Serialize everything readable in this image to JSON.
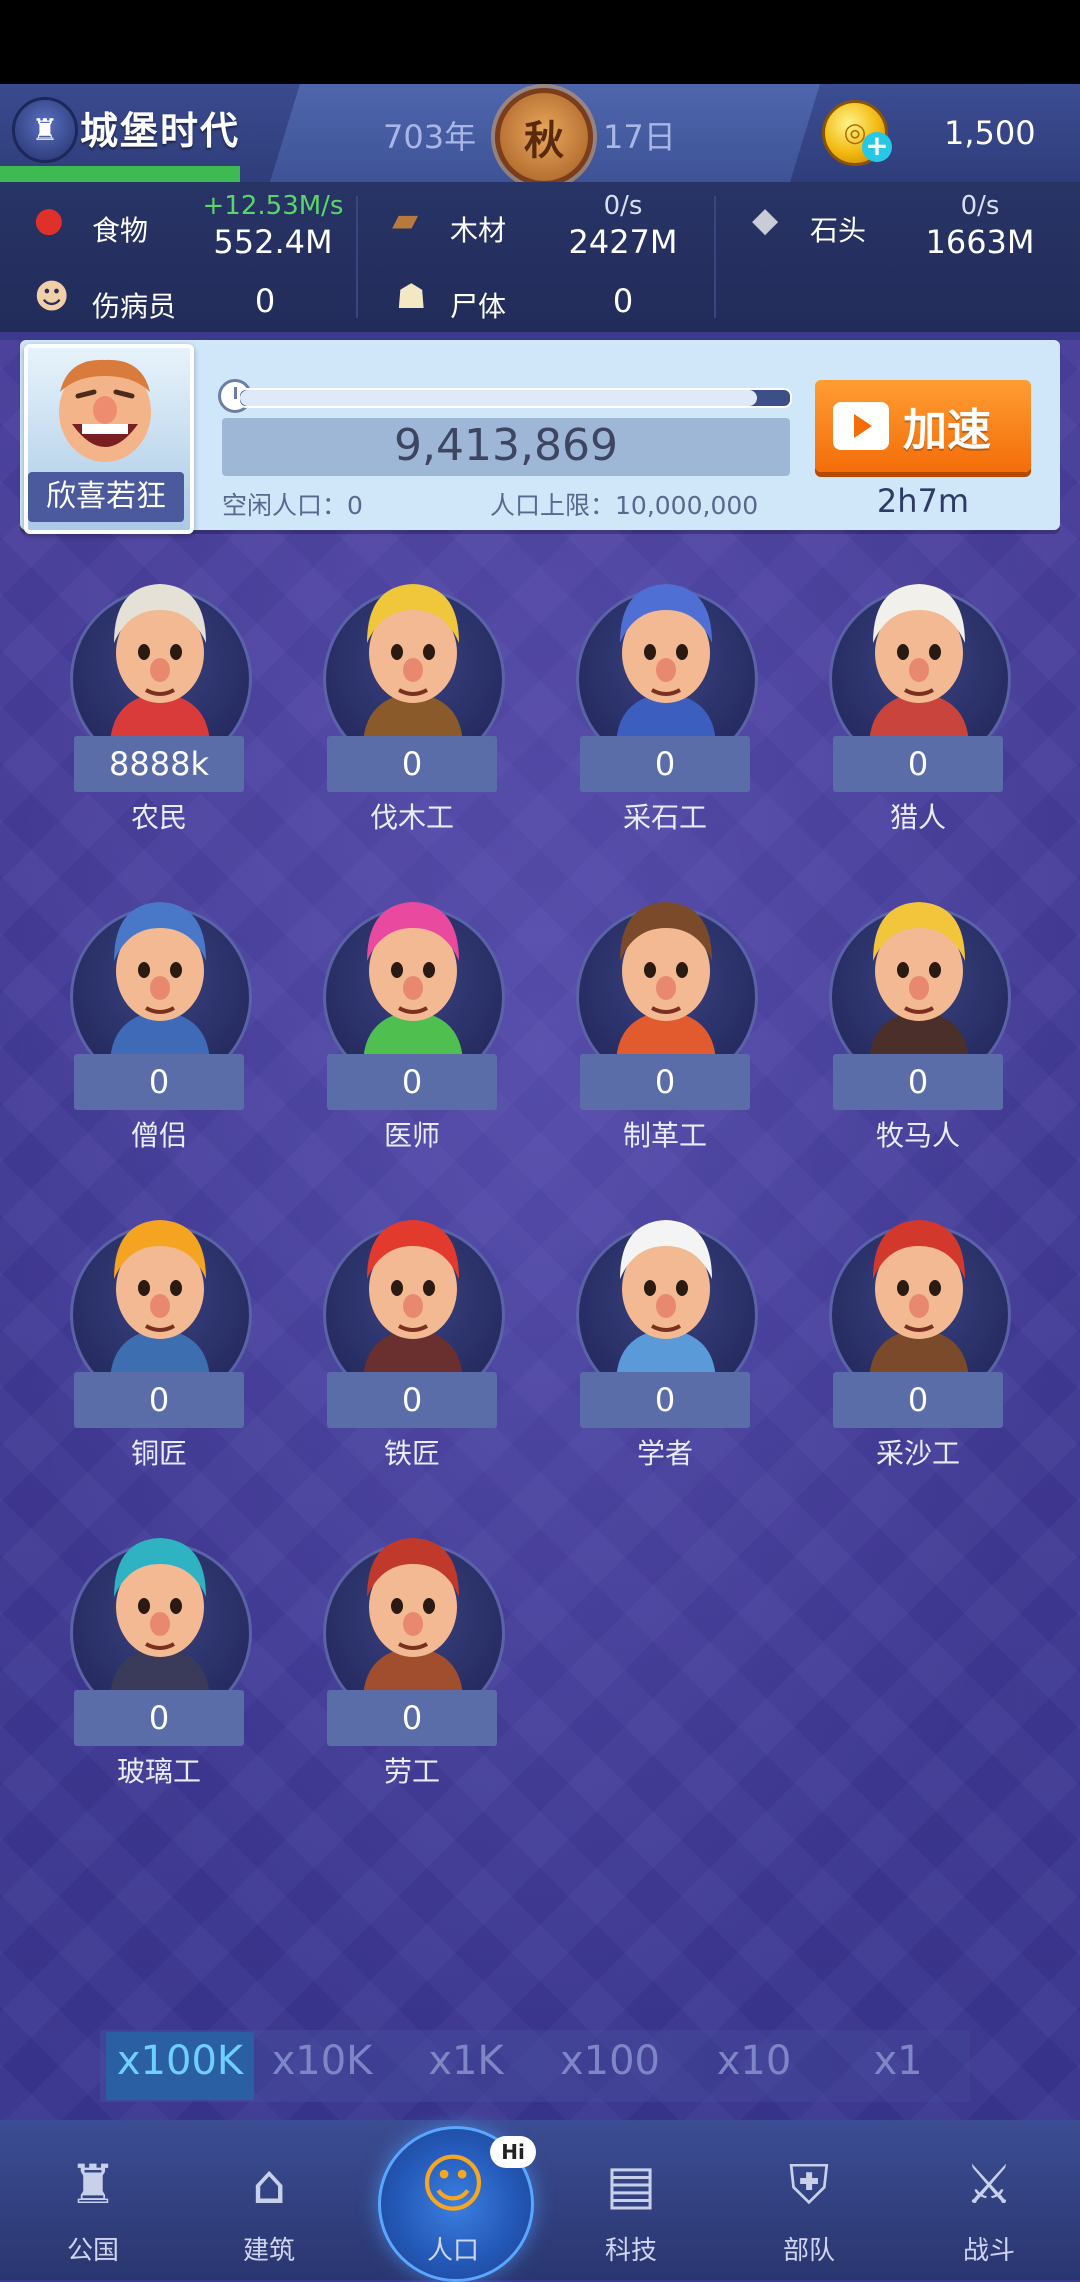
{
  "header": {
    "title": "城堡时代",
    "year": "703年",
    "season": "秋",
    "day": "17日",
    "coins": "1,500"
  },
  "resources": {
    "food": {
      "label": "食物",
      "rate": "+12.53M/s",
      "value": "552.4M",
      "icon": "apple-icon"
    },
    "wood": {
      "label": "木材",
      "rate": "0/s",
      "value": "2427M",
      "icon": "wood-icon"
    },
    "stone": {
      "label": "石头",
      "rate": "0/s",
      "value": "1663M",
      "icon": "stone-icon"
    },
    "wounded": {
      "label": "伤病员",
      "value": "0",
      "icon": "wounded-icon"
    },
    "corpse": {
      "label": "尸体",
      "value": "0",
      "icon": "corpse-icon"
    }
  },
  "population": {
    "mood": "欣喜若狂",
    "count": "9,413,869",
    "idle_label": "空闲人口：",
    "idle_value": "0",
    "limit_label": "人口上限：",
    "limit_value": "10,000,000",
    "progress": 0.94,
    "speed_label": "加速",
    "speed_time": "2h7m"
  },
  "workers": [
    {
      "name": "农民",
      "count": "8888k",
      "hair": "#e6e1d6",
      "shirt": "#d93a3a"
    },
    {
      "name": "伐木工",
      "count": "0",
      "hair": "#f0c63a",
      "shirt": "#8a5a2b"
    },
    {
      "name": "采石工",
      "count": "0",
      "hair": "#4f6fd4",
      "shirt": "#3c5fbf"
    },
    {
      "name": "猎人",
      "count": "0",
      "hair": "#f2f0ea",
      "shirt": "#c9443c"
    },
    {
      "name": "僧侣",
      "count": "0",
      "hair": "#4a78c8",
      "shirt": "#3e6ab8"
    },
    {
      "name": "医师",
      "count": "0",
      "hair": "#e94aa0",
      "shirt": "#4fbf4f"
    },
    {
      "name": "制革工",
      "count": "0",
      "hair": "#7a4a2a",
      "shirt": "#e25b2e"
    },
    {
      "name": "牧马人",
      "count": "0",
      "hair": "#f2c53a",
      "shirt": "#4a2f2a"
    },
    {
      "name": "铜匠",
      "count": "0",
      "hair": "#f4a421",
      "shirt": "#3d6fb0"
    },
    {
      "name": "铁匠",
      "count": "0",
      "hair": "#e23b2e",
      "shirt": "#6a3030"
    },
    {
      "name": "学者",
      "count": "0",
      "hair": "#f4f4f4",
      "shirt": "#5b9ad8"
    },
    {
      "name": "采沙工",
      "count": "0",
      "hair": "#d2392c",
      "shirt": "#7a4a2a"
    },
    {
      "name": "玻璃工",
      "count": "0",
      "hair": "#2fb2c2",
      "shirt": "#3a3a5a"
    },
    {
      "name": "劳工",
      "count": "0",
      "hair": "#c0392b",
      "shirt": "#a04e2e"
    }
  ],
  "multipliers": [
    "x100K",
    "x10K",
    "x1K",
    "x100",
    "x10",
    "x1"
  ],
  "multiplier_active": "x100K",
  "nav": [
    {
      "label": "公国",
      "icon": "castle-icon"
    },
    {
      "label": "建筑",
      "icon": "house-icon"
    },
    {
      "label": "人口",
      "icon": "person-icon",
      "badge": "Hi"
    },
    {
      "label": "科技",
      "icon": "book-icon"
    },
    {
      "label": "部队",
      "icon": "shield-icon"
    },
    {
      "label": "战斗",
      "icon": "swords-icon"
    }
  ]
}
